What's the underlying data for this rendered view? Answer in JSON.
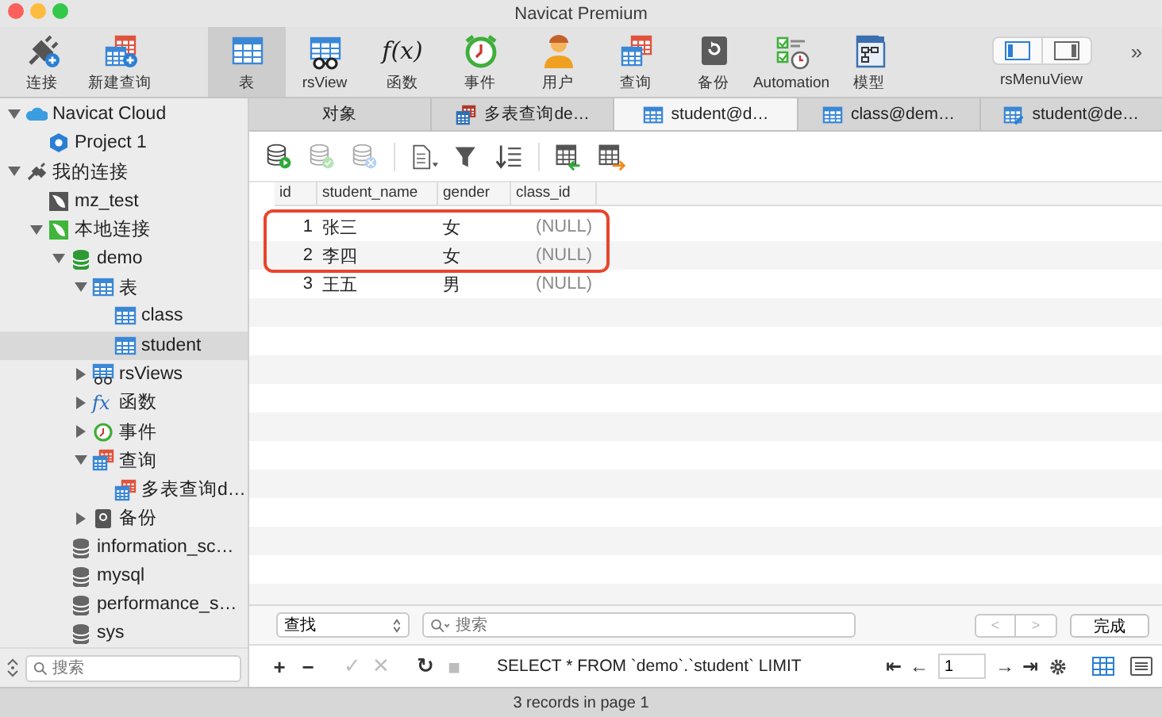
{
  "window": {
    "title": "Navicat Premium"
  },
  "toolbar": [
    {
      "label": "连接",
      "selected": false
    },
    {
      "label": "新建查询",
      "selected": false
    },
    {
      "label": "表",
      "selected": true
    },
    {
      "label": "rsView",
      "selected": false
    },
    {
      "label": "函数",
      "selected": false,
      "glyph": "f(x)"
    },
    {
      "label": "事件",
      "selected": false
    },
    {
      "label": "用户",
      "selected": false
    },
    {
      "label": "查询",
      "selected": false
    },
    {
      "label": "备份",
      "selected": false
    },
    {
      "label": "Automation",
      "selected": false
    },
    {
      "label": "模型",
      "selected": false
    }
  ],
  "view_switch": {
    "label": "rsMenuView",
    "segments": [
      {
        "selected": true
      },
      {
        "selected": false
      }
    ]
  },
  "more": "»",
  "tree": [
    {
      "label": "Navicat Cloud",
      "kind": "cloud",
      "expanded": true,
      "selected": false,
      "children": [
        {
          "label": "Project 1",
          "kind": "project",
          "selected": false
        }
      ]
    },
    {
      "label": "我的连接",
      "kind": "connections",
      "expanded": true,
      "selected": false,
      "children": [
        {
          "label": "mz_test",
          "kind": "server-off",
          "selected": false
        },
        {
          "label": "本地连接",
          "kind": "server-on",
          "expanded": true,
          "selected": false,
          "children": [
            {
              "label": "demo",
              "kind": "db-on",
              "expanded": true,
              "selected": false,
              "children": [
                {
                  "label": "表",
                  "kind": "tables",
                  "expanded": true,
                  "selected": false,
                  "children": [
                    {
                      "label": "class",
                      "kind": "table",
                      "selected": false
                    },
                    {
                      "label": "student",
                      "kind": "table",
                      "selected": true
                    }
                  ]
                },
                {
                  "label": "rsViews",
                  "kind": "views",
                  "expanded": false,
                  "selected": false
                },
                {
                  "label": "函数",
                  "kind": "functions",
                  "glyph": "fx",
                  "expanded": false,
                  "selected": false
                },
                {
                  "label": "事件",
                  "kind": "events",
                  "expanded": false,
                  "selected": false
                },
                {
                  "label": "查询",
                  "kind": "queries",
                  "expanded": true,
                  "selected": false,
                  "children": [
                    {
                      "label": "多表查询d…",
                      "kind": "query",
                      "selected": false
                    }
                  ]
                },
                {
                  "label": "备份",
                  "kind": "backups",
                  "expanded": false,
                  "selected": false
                }
              ]
            },
            {
              "label": "information_sc…",
              "kind": "db-off",
              "selected": false
            },
            {
              "label": "mysql",
              "kind": "db-off",
              "selected": false
            },
            {
              "label": "performance_s…",
              "kind": "db-off",
              "selected": false
            },
            {
              "label": "sys",
              "kind": "db-off",
              "selected": false
            }
          ]
        }
      ]
    }
  ],
  "sidebar_search": {
    "placeholder": "搜索"
  },
  "tabs": [
    {
      "label": "对象",
      "kind": "objects",
      "selected": false
    },
    {
      "label": "多表查询de…",
      "kind": "query",
      "selected": false
    },
    {
      "label": "student@d…",
      "kind": "table",
      "selected": true
    },
    {
      "label": "class@dem…",
      "kind": "table",
      "selected": false
    },
    {
      "label": "student@de…",
      "kind": "design",
      "selected": false
    }
  ],
  "data_tools": [
    {
      "disabled": false
    },
    {
      "disabled": true
    },
    {
      "disabled": true
    },
    {
      "disabled": false
    },
    {
      "disabled": false
    },
    {
      "disabled": false
    },
    {
      "disabled": false
    },
    {
      "disabled": false
    }
  ],
  "table": {
    "columns": [
      {
        "label": "id"
      },
      {
        "label": "student_name"
      },
      {
        "label": "gender"
      },
      {
        "label": "class_id"
      }
    ],
    "rows": [
      {
        "highlighted": true,
        "cells": [
          {
            "text": "1",
            "null": false
          },
          {
            "text": "张三",
            "null": false
          },
          {
            "text": "女",
            "null": false
          },
          {
            "text": "(NULL)",
            "null": true
          }
        ]
      },
      {
        "highlighted": true,
        "cells": [
          {
            "text": "2",
            "null": false
          },
          {
            "text": "李四",
            "null": false
          },
          {
            "text": "女",
            "null": false
          },
          {
            "text": "(NULL)",
            "null": true
          }
        ]
      },
      {
        "highlighted": false,
        "cells": [
          {
            "text": "3",
            "null": false
          },
          {
            "text": "王五",
            "null": false
          },
          {
            "text": "男",
            "null": false
          },
          {
            "text": "(NULL)",
            "null": true
          }
        ]
      }
    ]
  },
  "find_bar": {
    "mode": "查找",
    "placeholder": "搜索",
    "prev": {
      "label": "<",
      "disabled": true
    },
    "next": {
      "label": ">",
      "disabled": true
    },
    "done": "完成"
  },
  "sql_bar": {
    "actions": [
      {
        "label": "+",
        "disabled": false
      },
      {
        "label": "−",
        "disabled": false
      },
      {
        "label": "✓",
        "disabled": true
      },
      {
        "label": "✕",
        "disabled": true
      },
      {
        "label": "↻",
        "disabled": false
      },
      {
        "label": "■",
        "disabled": true
      }
    ],
    "query": "SELECT * FROM `demo`.`student` LIMIT",
    "nav": [
      {
        "label": "⇤"
      },
      {
        "label": "←"
      }
    ],
    "page": "1",
    "nav_after": [
      {
        "label": "→"
      },
      {
        "label": "⇥"
      }
    ],
    "views": [
      {
        "selected": true
      },
      {
        "selected": false
      }
    ]
  },
  "status_bar": "3 records in page 1"
}
